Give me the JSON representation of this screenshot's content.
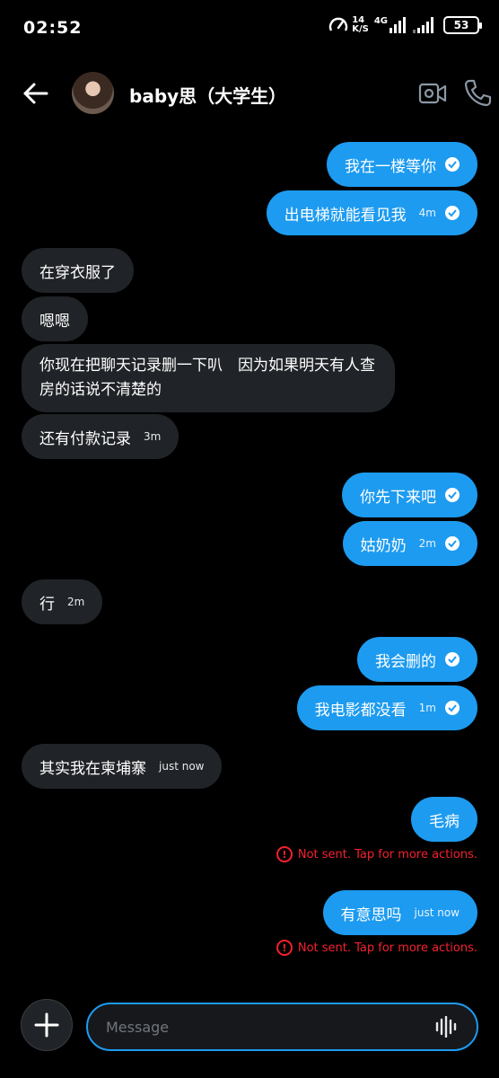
{
  "status": {
    "time": "02:52",
    "speed_value": "14",
    "speed_unit": "K/S",
    "network": "4G",
    "battery": "53"
  },
  "header": {
    "contact_name": "baby思（大学生）"
  },
  "messages": [
    {
      "text": "我在一楼等你",
      "time": ""
    },
    {
      "text": "出电梯就能看见我",
      "time": "4m"
    },
    {
      "text": "在穿衣服了",
      "time": ""
    },
    {
      "text": "嗯嗯",
      "time": ""
    },
    {
      "text": "你现在把聊天记录删一下叭　因为如果明天有人查房的话说不清楚的",
      "time": ""
    },
    {
      "text": "还有付款记录",
      "time": "3m"
    },
    {
      "text": "你先下来吧",
      "time": ""
    },
    {
      "text": "姑奶奶",
      "time": "2m"
    },
    {
      "text": "行",
      "time": "2m"
    },
    {
      "text": "我会删的",
      "time": ""
    },
    {
      "text": "我电影都没看",
      "time": "1m"
    },
    {
      "text": "其实我在柬埔寨",
      "time": "just now"
    },
    {
      "text": "毛病",
      "time": ""
    },
    {
      "text": "有意思吗",
      "time": "just now"
    }
  ],
  "error_text": "Not sent. Tap for more actions.",
  "composer": {
    "placeholder": "Message"
  },
  "colors": {
    "outgoing": "#1d9bf0",
    "incoming": "#202327",
    "error": "#f4212e"
  }
}
